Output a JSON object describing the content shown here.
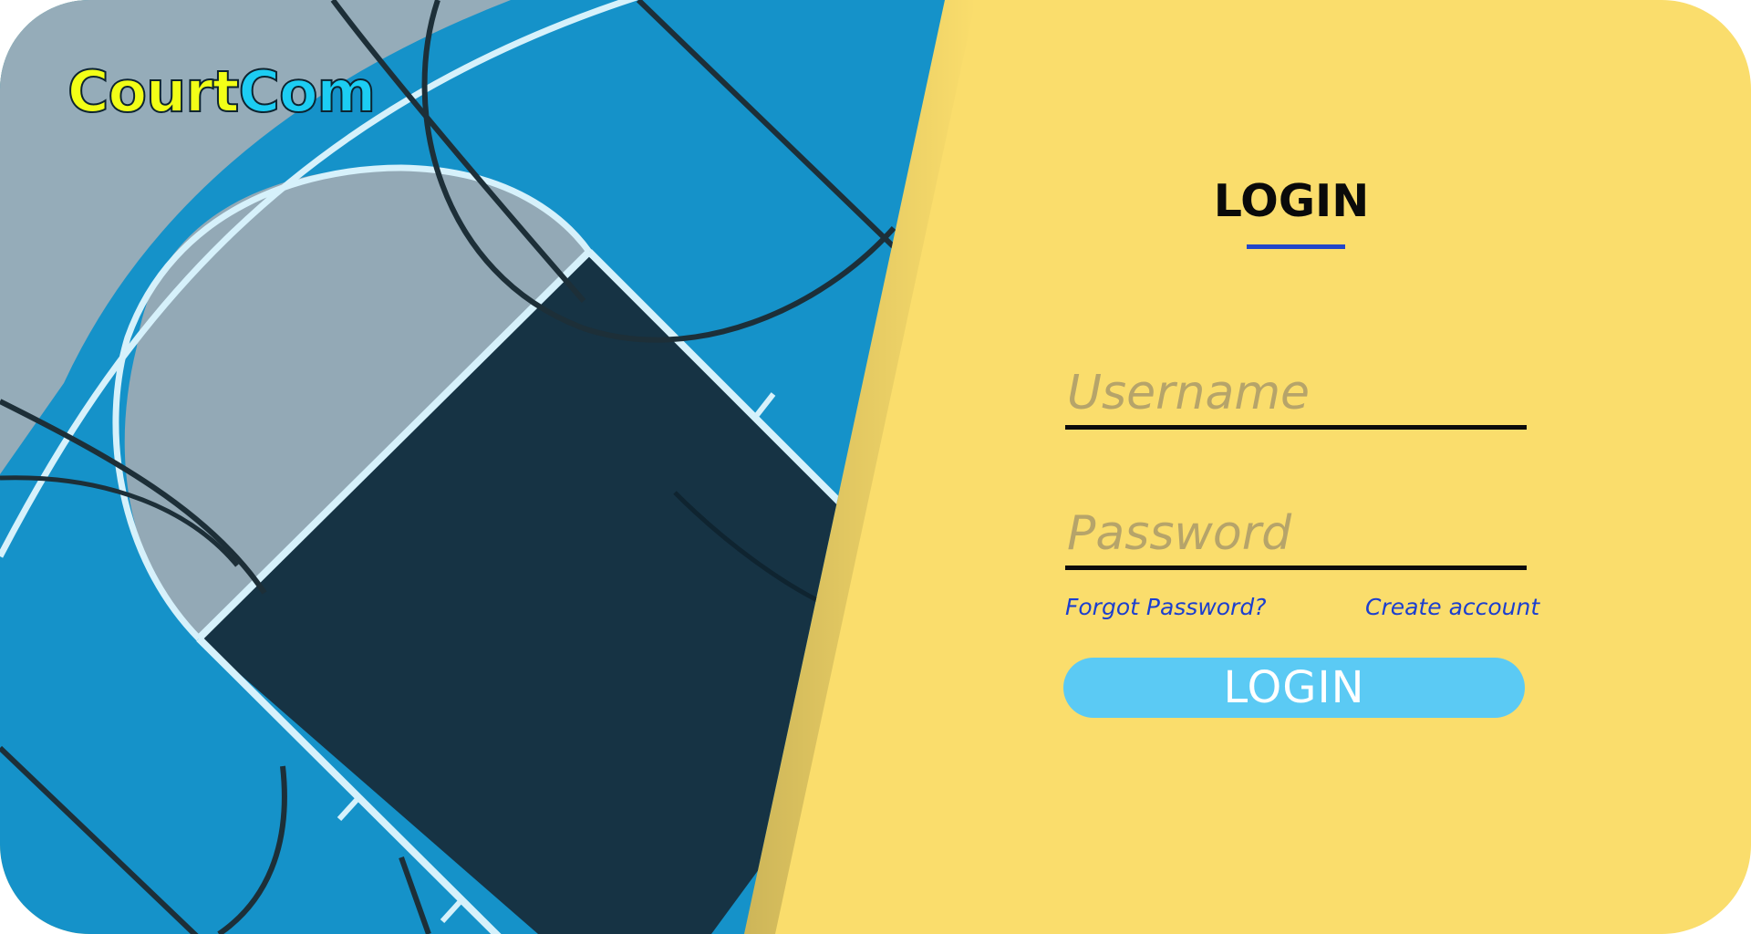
{
  "brand": {
    "part1": "Court",
    "part2": "Com"
  },
  "colors": {
    "panel_background": "#fadd6c",
    "court_blue": "#1592c9",
    "court_gray": "#93acb9",
    "court_dark": "#163344",
    "court_lines": "#d6f1fb",
    "brand_yellow": "#f2ff17",
    "brand_cyan": "#1ccdf3",
    "link_blue": "#1c3fcf",
    "title_underline": "#2246c9",
    "button_background": "#5bcaf4"
  },
  "login": {
    "title": "LOGIN",
    "username_placeholder": "Username",
    "password_placeholder": "Password",
    "forgot_password": "Forgot Password?",
    "create_account": "Create account",
    "button_label": "LOGIN"
  }
}
